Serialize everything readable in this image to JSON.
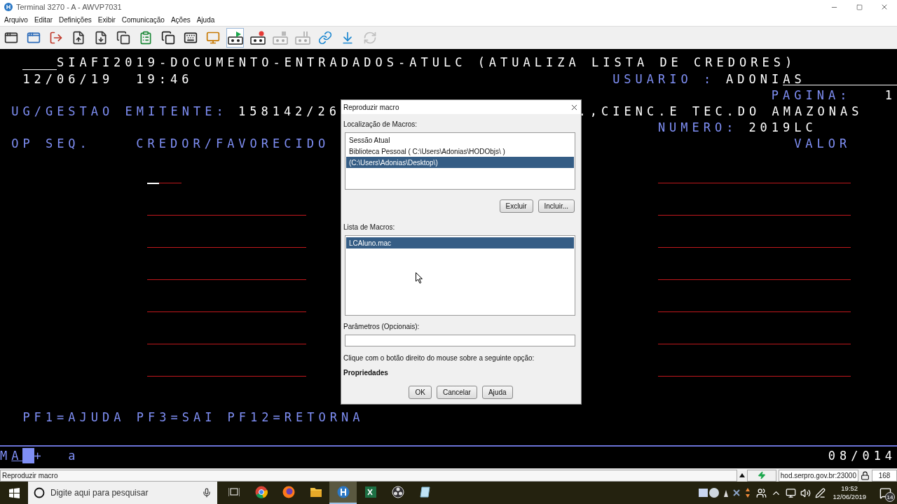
{
  "window": {
    "title": "Terminal 3270 - A - AWVP7031"
  },
  "menu": [
    "Arquivo",
    "Editar",
    "Definições",
    "Exibir",
    "Comunicação",
    "Ações",
    "Ajuda"
  ],
  "toolbar": [
    {
      "pressed": false,
      "disabled": false
    },
    {
      "pressed": false,
      "disabled": false
    },
    {
      "pressed": false,
      "disabled": false
    },
    {
      "pressed": false,
      "disabled": false
    },
    {
      "pressed": false,
      "disabled": false
    },
    {
      "pressed": false,
      "disabled": false
    },
    {
      "pressed": false,
      "disabled": false
    },
    {
      "pressed": false,
      "disabled": false
    },
    {
      "pressed": false,
      "disabled": false
    },
    {
      "pressed": false,
      "disabled": false
    },
    {
      "pressed": true,
      "disabled": false
    },
    {
      "pressed": false,
      "disabled": false
    },
    {
      "pressed": false,
      "disabled": true
    },
    {
      "pressed": false,
      "disabled": true
    },
    {
      "pressed": false,
      "disabled": false
    },
    {
      "pressed": false,
      "disabled": false
    },
    {
      "pressed": false,
      "disabled": true
    }
  ],
  "terminal": {
    "lines": [
      [
        {
          "text": "SIAFI2019-DOCUMENTO-ENTRADADOS-ATULC (ATUALIZA LISTA DE CREDORES)",
          "kind": "value"
        }
      ],
      [
        {
          "text": "12/06/19",
          "kind": "value"
        },
        {
          "text": "19:46",
          "kind": "value"
        },
        {
          "text": "USUARIO :",
          "kind": "label"
        },
        {
          "text": "ADONIAS",
          "kind": "value"
        }
      ],
      [
        {
          "text": "PAGINA:",
          "kind": "label"
        },
        {
          "text": "1",
          "kind": "value"
        }
      ],
      [
        {
          "text": "UG/GESTAO EMITENTE:",
          "kind": "label"
        },
        {
          "text": "158142/26",
          "kind": "value"
        },
        {
          "text": ".,CIENC.E TEC.DO AMAZONAS",
          "kind": "value"
        }
      ],
      [
        {
          "text": "NUMERO:",
          "kind": "label"
        },
        {
          "text": "2019LC",
          "kind": "value"
        }
      ],
      [
        {
          "text": "OP SEQ.",
          "kind": "label"
        },
        {
          "text": "CREDOR/FAVORECIDO",
          "kind": "label"
        },
        {
          "text": "VALOR",
          "kind": "label"
        }
      ]
    ],
    "entry_rows": [
      {
        "cursor": true
      },
      {
        "cursor": false
      },
      {
        "cursor": false
      },
      {
        "cursor": false
      },
      {
        "cursor": false
      },
      {
        "cursor": false
      },
      {
        "cursor": false
      }
    ],
    "function_keys": "PF1=AJUDA PF3=SAI PF12=RETORNA",
    "status": {
      "mode": "MA",
      "sign": "+",
      "char": "a",
      "position": "08/014"
    }
  },
  "dialog": {
    "title": "Reproduzir macro",
    "locations_label": "Localização de Macros:",
    "locations": [
      {
        "label": "Sessão Atual",
        "selected": false
      },
      {
        "label": "Biblioteca Pessoal ( C:\\Users\\Adonias\\HODObjs\\ )",
        "selected": false
      },
      {
        "label": "(C:\\Users\\Adonias\\Desktop\\)",
        "selected": true
      }
    ],
    "location_buttons": [
      "Excluir",
      "Incluir..."
    ],
    "macros_label": "Lista de Macros:",
    "macros": [
      {
        "label": "LCAluno.mac",
        "selected": true
      }
    ],
    "params_label": "Parâmetros (Opcionais):",
    "hint": "Clique com o botão direito do mouse sobre a seguinte opção:",
    "option": "Propriedades",
    "buttons": [
      "OK",
      "Cancelar",
      "Ajuda"
    ]
  },
  "status_bar": {
    "message": "Reproduzir macro",
    "host": "hod.serpro.gov.br:23000",
    "count": "168"
  },
  "taskbar": {
    "search_placeholder": "Digite aqui para pesquisar",
    "apps": [
      {
        "selected": false
      },
      {
        "selected": false
      },
      {
        "selected": false
      },
      {
        "selected": true
      },
      {
        "selected": false
      },
      {
        "selected": false
      },
      {
        "selected": false
      }
    ],
    "time": "19:52",
    "date": "12/06/2019",
    "notifications": "14"
  }
}
